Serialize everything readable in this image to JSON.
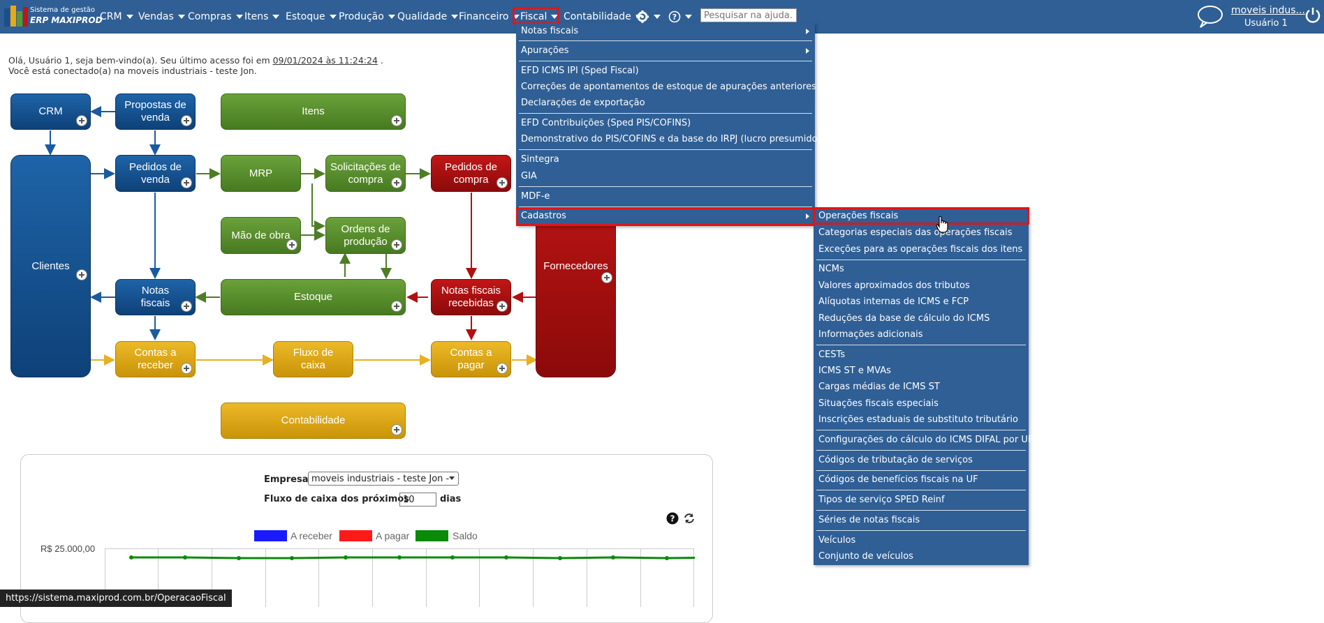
{
  "app": {
    "logo_line1": "Sistema de gestão",
    "logo_line2": "ERP MAXIPROD"
  },
  "menu": {
    "items": [
      {
        "label": "CRM"
      },
      {
        "label": "Vendas"
      },
      {
        "label": "Compras"
      },
      {
        "label": "Itens"
      },
      {
        "label": "Estoque"
      },
      {
        "label": "Produção"
      },
      {
        "label": "Qualidade"
      },
      {
        "label": "Financeiro"
      },
      {
        "label": "Fiscal"
      },
      {
        "label": "Contabilidade"
      }
    ],
    "search_placeholder": "Pesquisar na ajuda...",
    "user_link": "moveis indus...",
    "user_name": "Usuário 1"
  },
  "welcome": {
    "line1_prefix": "Olá, Usuário 1, seja bem-vindo(a). Seu último acesso foi em ",
    "last_access": "09/01/2024 às 11:24:24",
    "line1_suffix": ".",
    "line2": "Você está conectado(a) na moveis industriais - teste Jon."
  },
  "flow": {
    "crm": "CRM",
    "propostas": "Propostas de venda",
    "itens": "Itens",
    "clientes": "Clientes",
    "pedidos_venda": "Pedidos de venda",
    "mrp": "MRP",
    "solicitacoes": "Solicitações de compra",
    "pedidos_compra": "Pedidos de compra",
    "mao_obra": "Mão de obra",
    "ordens": "Ordens de produção",
    "fornecedores": "Fornecedores",
    "notas_fiscais": "Notas fiscais",
    "estoque": "Estoque",
    "notas_recebidas": "Notas fiscais recebidas",
    "contas_receber": "Contas a receber",
    "fluxo_caixa": "Fluxo de caixa",
    "contas_pagar": "Contas a pagar",
    "contabilidade": "Contabilidade"
  },
  "fiscal_menu": {
    "items": [
      "Notas fiscais",
      "Apurações",
      "EFD ICMS IPI (Sped Fiscal)",
      "Correções de apontamentos de estoque de apurações anteriores",
      "Declarações de exportação",
      "EFD Contribuições (Sped PIS/COFINS)",
      "Demonstrativo do PIS/COFINS e da base do IRPJ (lucro presumido)",
      "Sintegra",
      "GIA",
      "MDF-e",
      "Cadastros"
    ]
  },
  "cadastros_menu": {
    "items": [
      "Operações fiscais",
      "Categorias especiais das operações fiscais",
      "Exceções para as operações fiscais dos itens",
      "NCMs",
      "Valores aproximados dos tributos",
      "Alíquotas internas de ICMS e FCP",
      "Reduções da base de cálculo do ICMS",
      "Informações adicionais",
      "CESTs",
      "ICMS ST e MVAs",
      "Cargas médias de ICMS ST",
      "Situações fiscais especiais",
      "Inscrições estaduais de substituto tributário",
      "Configurações do cálculo do ICMS DIFAL por UF",
      "Códigos de tributação de serviços",
      "Códigos de benefícios fiscais na UF",
      "Tipos de serviço SPED Reinf",
      "Séries de notas fiscais",
      "Veículos",
      "Conjunto de veículos"
    ]
  },
  "panel": {
    "empresa_label": "Empresa",
    "empresa_value": "moveis industriais - teste Jon -",
    "fluxo_label": "Fluxo de caixa dos próximos",
    "fluxo_value": "10",
    "dias_label": "dias",
    "legend": [
      "A receber",
      "A pagar",
      "Saldo"
    ],
    "legend_colors": [
      "#1a1aff",
      "#ff1a1a",
      "#0a8a0a"
    ],
    "y_tick": "R$ 25.000,00"
  },
  "status_bar": "https://sistema.maxiprod.com.br/OperacaoFiscal"
}
